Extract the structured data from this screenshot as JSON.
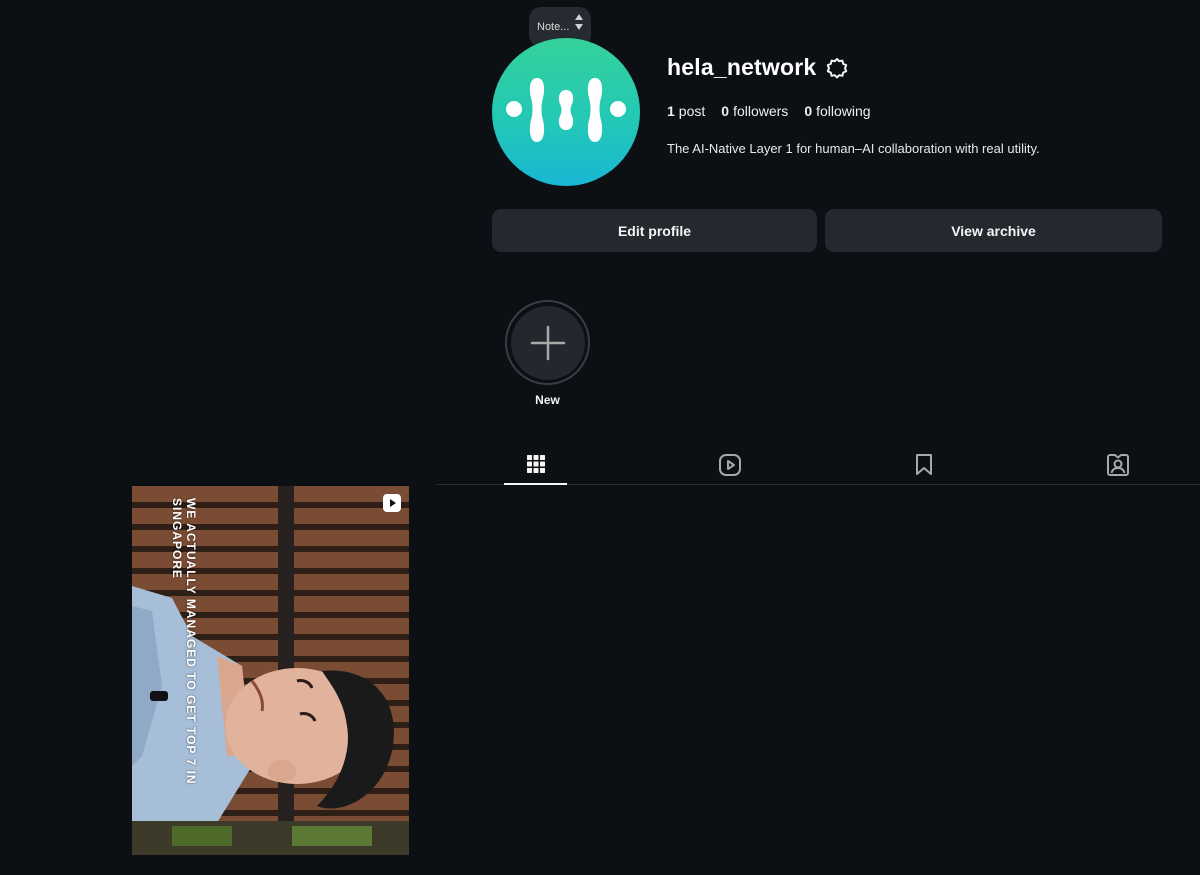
{
  "note": {
    "label": "Note..."
  },
  "profile": {
    "username": "hela_network",
    "stats": [
      {
        "count": "1",
        "label": "post"
      },
      {
        "count": "0",
        "label": "followers"
      },
      {
        "count": "0",
        "label": "following"
      }
    ],
    "bio": "The AI-Native Layer 1 for human–AI collaboration with real utility."
  },
  "buttons": {
    "edit_profile": "Edit profile",
    "view_archive": "View archive"
  },
  "highlights": {
    "new_label": "New"
  },
  "tabs": [
    {
      "name": "posts",
      "icon": "grid-icon",
      "active": true
    },
    {
      "name": "reels",
      "icon": "reels-icon",
      "active": false
    },
    {
      "name": "saved",
      "icon": "bookmark-icon",
      "active": false
    },
    {
      "name": "tagged",
      "icon": "tagged-icon",
      "active": false
    }
  ],
  "posts": [
    {
      "type": "reel",
      "caption": "WE ACTUALLY MANAGED TO GET TOP 7 IN SINGAPORE"
    }
  ],
  "colors": {
    "background": "#0c0f14",
    "button": "#25292f",
    "avatar_top": "#34d29a",
    "avatar_bottom": "#19b6d4"
  }
}
